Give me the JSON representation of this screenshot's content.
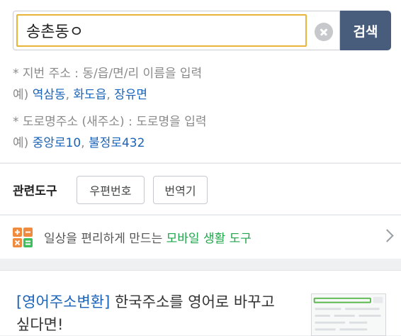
{
  "search": {
    "value": "송촌동ㅇ",
    "button_label": "검색"
  },
  "help": {
    "lot_hint": "지번 주소 : 동/읍/면/리 이름을 입력",
    "lot_prefix": "예)",
    "lot_examples": [
      "역삼동",
      "화도읍",
      "장유면"
    ],
    "road_hint": "도로명주소 (새주소) : 도로명을 입력",
    "road_prefix": "예)",
    "road_examples": [
      "중앙로10",
      "불정로432"
    ],
    "star": "*"
  },
  "tools": {
    "label": "관련도구",
    "buttons": [
      "우편번호",
      "번역기"
    ]
  },
  "promo": {
    "text_before": "일상을 편리하게 만드는",
    "text_highlight": "모바일 생활 도구"
  },
  "ad": {
    "link_text": "[영어주소변환]",
    "text": " 한국주소를 영어로 바꾸고 싶다면!"
  },
  "colors": {
    "accent_border": "#e8b43c",
    "search_button": "#475d7b",
    "link": "#1a63b8",
    "highlight_green": "#1fa54b"
  }
}
